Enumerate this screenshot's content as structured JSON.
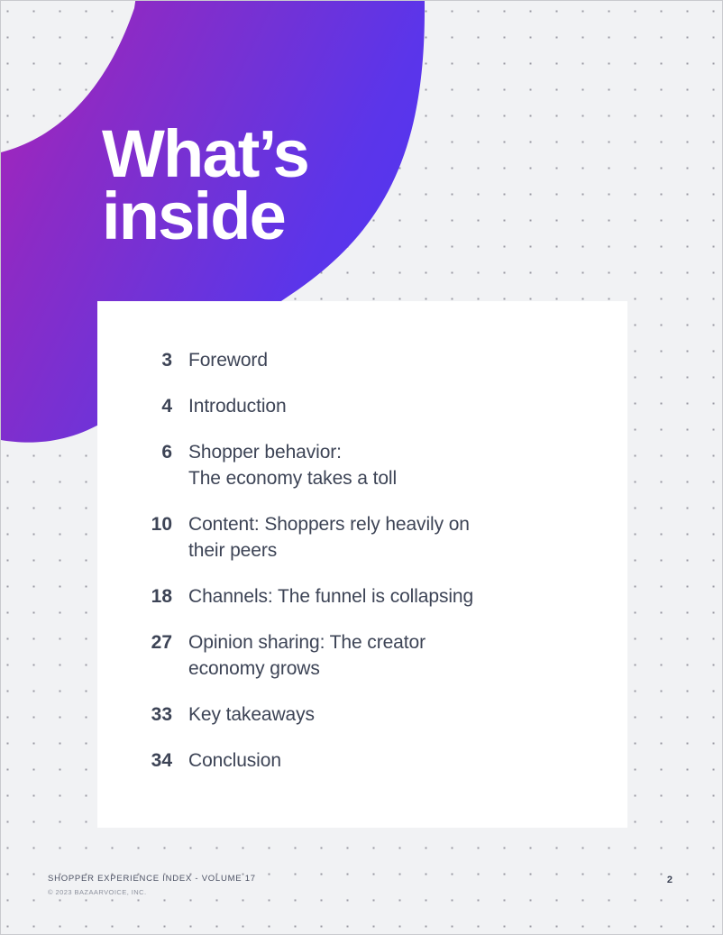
{
  "document": {
    "heading_line1": "What’s",
    "heading_line2": "inside",
    "heading_full": "What’s\ninside"
  },
  "toc": {
    "entries": [
      {
        "page": "3",
        "label": "Foreword"
      },
      {
        "page": "4",
        "label": "Introduction"
      },
      {
        "page": "6",
        "label": "Shopper behavior:\nThe economy takes a toll"
      },
      {
        "page": "10",
        "label": "Content: Shoppers rely heavily on\ntheir peers"
      },
      {
        "page": "18",
        "label": "Channels: The funnel is collapsing"
      },
      {
        "page": "27",
        "label": "Opinion sharing: The creator\neconomy grows"
      },
      {
        "page": "33",
        "label": "Key takeaways"
      },
      {
        "page": "34",
        "label": "Conclusion"
      }
    ]
  },
  "footer": {
    "title": "SHOPPER EXPERIENCE INDEX - VOLUME 17",
    "copyright": "© 2023 BAZAARVOICE, INC.",
    "page_number": "2"
  },
  "colors": {
    "background": "#f1f2f4",
    "card": "#ffffff",
    "text_dark": "#3d4456",
    "gradient_magenta": "#9B27C0",
    "gradient_purple": "#7C2FCD",
    "gradient_violet": "#6A40DE",
    "gradient_blue": "#5435EC",
    "dot": "#9a9aa3"
  }
}
